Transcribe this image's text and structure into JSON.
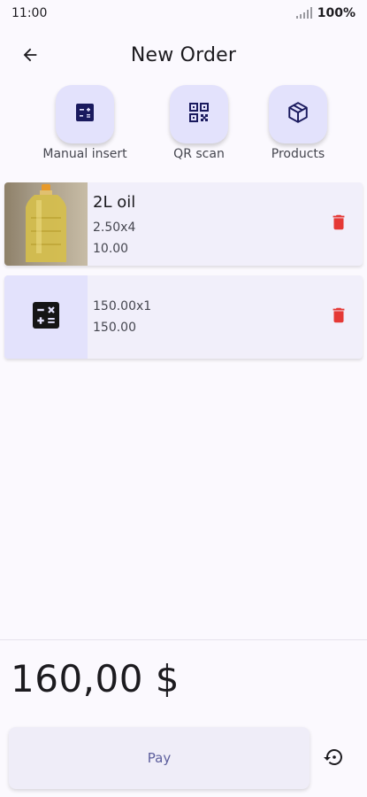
{
  "status_bar": {
    "time": "11:00",
    "battery": "100%"
  },
  "header": {
    "title": "New Order",
    "back_icon": "arrow-back-icon"
  },
  "actions": [
    {
      "label": "Manual insert",
      "icon": "calculator-icon"
    },
    {
      "label": "QR scan",
      "icon": "qr-code-icon"
    },
    {
      "label": "Products",
      "icon": "package-icon"
    }
  ],
  "items": [
    {
      "name": "2L oil",
      "quantity": "2.50x4",
      "total": "10.00",
      "thumbnail": "oil-bottle-photo"
    },
    {
      "name": "",
      "quantity": "150.00x1",
      "total": "150.00",
      "thumbnail": "calculator-icon"
    }
  ],
  "footer": {
    "total": "160,00 $",
    "pay_label": "Pay",
    "history_icon": "history-icon"
  },
  "colors": {
    "accent_tile": "#e3e2fc",
    "icon_dark": "#1a1a5e",
    "delete": "#e53935"
  }
}
